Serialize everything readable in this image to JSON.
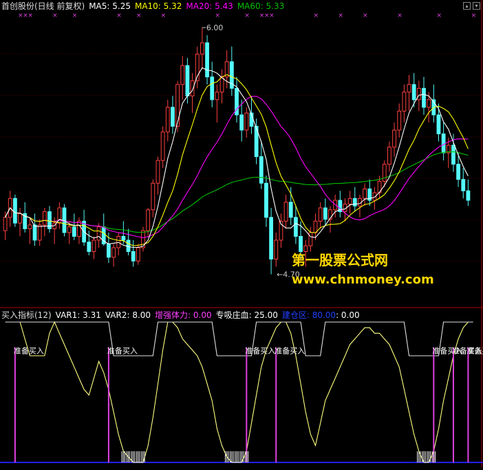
{
  "header_top": {
    "stock": "首创股份(日线 前复权)",
    "ma5": "MA5: 5.25",
    "ma10": "MA10: 5.32",
    "ma20": "MA20: 5.43",
    "ma60": "MA60: 5.33"
  },
  "header_bottom": {
    "name": "买入指标(12)",
    "var1": "VAR1: 3.31",
    "var2": "VAR2: 8.00",
    "zqtl": "增强体力: 0.00",
    "zxzx": "专吸庄血: 25.00",
    "zone": "建仓区: 80.00",
    "last": ": 0.00"
  },
  "watermark": {
    "line1": "第一股票公式网",
    "line2": "www.chnmoney.com"
  },
  "colors": {
    "up": "#ff4040",
    "down": "#54fcfc",
    "ma5": "#ffffff",
    "ma10": "#ffff00",
    "ma20": "#ff00ff",
    "ma60": "#00c000",
    "magenta": "#e040e0",
    "blue": "#2020ff"
  },
  "chart_data": {
    "type": "candlestick",
    "price_range": [
      4.55,
      6.08
    ],
    "high_label": "6.00",
    "low_label": "4.70",
    "candles": [
      [
        4.93,
        5.03,
        4.88,
        5.0
      ],
      [
        5.0,
        5.14,
        4.95,
        5.1
      ],
      [
        5.1,
        5.12,
        4.95,
        4.97
      ],
      [
        4.97,
        5.05,
        4.9,
        5.02
      ],
      [
        5.02,
        5.08,
        4.92,
        4.94
      ],
      [
        4.94,
        5.0,
        4.86,
        4.96
      ],
      [
        4.96,
        5.02,
        4.85,
        4.88
      ],
      [
        4.88,
        4.99,
        4.85,
        4.96
      ],
      [
        4.96,
        5.05,
        4.9,
        5.03
      ],
      [
        5.03,
        5.06,
        4.92,
        4.94
      ],
      [
        4.94,
        5.0,
        4.86,
        4.97
      ],
      [
        4.97,
        5.08,
        4.94,
        5.05
      ],
      [
        5.05,
        5.07,
        4.9,
        4.92
      ],
      [
        4.92,
        4.98,
        4.86,
        4.95
      ],
      [
        4.95,
        5.02,
        4.88,
        4.9
      ],
      [
        4.9,
        5.0,
        4.86,
        4.98
      ],
      [
        4.98,
        5.04,
        4.85,
        4.87
      ],
      [
        4.87,
        4.93,
        4.8,
        4.82
      ],
      [
        4.82,
        4.9,
        4.78,
        4.88
      ],
      [
        4.88,
        4.97,
        4.84,
        4.95
      ],
      [
        4.95,
        5.02,
        4.85,
        4.86
      ],
      [
        4.86,
        4.92,
        4.76,
        4.79
      ],
      [
        4.79,
        4.86,
        4.74,
        4.84
      ],
      [
        4.84,
        4.92,
        4.8,
        4.9
      ],
      [
        4.9,
        4.98,
        4.86,
        4.88
      ],
      [
        4.88,
        4.94,
        4.8,
        4.82
      ],
      [
        4.82,
        4.88,
        4.74,
        4.77
      ],
      [
        4.77,
        4.86,
        4.75,
        4.84
      ],
      [
        4.84,
        4.95,
        4.82,
        4.93
      ],
      [
        4.93,
        5.05,
        4.9,
        5.04
      ],
      [
        5.04,
        5.2,
        5.0,
        5.18
      ],
      [
        5.18,
        5.32,
        5.12,
        5.3
      ],
      [
        5.3,
        5.48,
        5.26,
        5.45
      ],
      [
        5.45,
        5.62,
        5.4,
        5.58
      ],
      [
        5.58,
        5.64,
        5.44,
        5.48
      ],
      [
        5.48,
        5.72,
        5.45,
        5.7
      ],
      [
        5.7,
        5.85,
        5.62,
        5.8
      ],
      [
        5.8,
        5.84,
        5.6,
        5.64
      ],
      [
        5.64,
        5.76,
        5.55,
        5.72
      ],
      [
        5.72,
        5.9,
        5.68,
        5.86
      ],
      [
        5.86,
        6.0,
        5.78,
        5.92
      ],
      [
        5.92,
        5.96,
        5.7,
        5.74
      ],
      [
        5.74,
        5.82,
        5.58,
        5.62
      ],
      [
        5.62,
        5.7,
        5.5,
        5.66
      ],
      [
        5.66,
        5.78,
        5.6,
        5.74
      ],
      [
        5.74,
        5.88,
        5.68,
        5.82
      ],
      [
        5.82,
        5.9,
        5.64,
        5.68
      ],
      [
        5.68,
        5.74,
        5.5,
        5.54
      ],
      [
        5.54,
        5.62,
        5.4,
        5.46
      ],
      [
        5.46,
        5.58,
        5.42,
        5.55
      ],
      [
        5.55,
        5.64,
        5.44,
        5.48
      ],
      [
        5.48,
        5.52,
        5.28,
        5.32
      ],
      [
        5.32,
        5.4,
        5.15,
        5.18
      ],
      [
        5.18,
        5.22,
        4.95,
        5.0
      ],
      [
        5.0,
        5.05,
        4.7,
        4.78
      ],
      [
        4.78,
        4.92,
        4.74,
        4.88
      ],
      [
        4.88,
        5.02,
        4.84,
        4.98
      ],
      [
        4.98,
        5.12,
        4.94,
        5.08
      ],
      [
        5.08,
        5.16,
        4.96,
        5.0
      ],
      [
        5.0,
        5.06,
        4.86,
        4.9
      ],
      [
        4.9,
        4.98,
        4.78,
        4.82
      ],
      [
        4.82,
        4.88,
        4.74,
        4.85
      ],
      [
        4.85,
        4.95,
        4.82,
        4.92
      ],
      [
        4.92,
        5.02,
        4.88,
        4.98
      ],
      [
        4.98,
        5.08,
        4.94,
        5.05
      ],
      [
        5.05,
        5.1,
        4.96,
        4.99
      ],
      [
        4.99,
        5.06,
        4.92,
        5.04
      ],
      [
        5.04,
        5.12,
        5.0,
        5.09
      ],
      [
        5.09,
        5.14,
        5.0,
        5.03
      ],
      [
        5.03,
        5.1,
        4.98,
        5.07
      ],
      [
        5.07,
        5.14,
        5.02,
        5.1
      ],
      [
        5.1,
        5.16,
        5.03,
        5.06
      ],
      [
        5.06,
        5.12,
        5.0,
        5.1
      ],
      [
        5.1,
        5.18,
        5.06,
        5.15
      ],
      [
        5.15,
        5.2,
        5.06,
        5.09
      ],
      [
        5.09,
        5.16,
        5.04,
        5.13
      ],
      [
        5.13,
        5.22,
        5.1,
        5.19
      ],
      [
        5.19,
        5.3,
        5.16,
        5.28
      ],
      [
        5.28,
        5.4,
        5.24,
        5.37
      ],
      [
        5.37,
        5.5,
        5.32,
        5.46
      ],
      [
        5.46,
        5.6,
        5.42,
        5.56
      ],
      [
        5.56,
        5.7,
        5.5,
        5.66
      ],
      [
        5.66,
        5.75,
        5.56,
        5.7
      ],
      [
        5.7,
        5.76,
        5.58,
        5.62
      ],
      [
        5.62,
        5.72,
        5.56,
        5.68
      ],
      [
        5.68,
        5.74,
        5.54,
        5.58
      ],
      [
        5.58,
        5.66,
        5.5,
        5.62
      ],
      [
        5.62,
        5.7,
        5.5,
        5.54
      ],
      [
        5.54,
        5.6,
        5.4,
        5.44
      ],
      [
        5.44,
        5.5,
        5.3,
        5.34
      ],
      [
        5.34,
        5.42,
        5.26,
        5.38
      ],
      [
        5.38,
        5.44,
        5.24,
        5.28
      ],
      [
        5.28,
        5.34,
        5.16,
        5.2
      ],
      [
        5.2,
        5.26,
        5.1,
        5.14
      ],
      [
        5.14,
        5.2,
        5.06,
        5.09
      ]
    ],
    "ind_range": [
      0,
      25
    ],
    "osc": [
      25,
      25,
      25,
      25,
      22,
      19,
      19,
      19,
      19,
      23,
      25,
      23,
      21,
      19,
      17,
      15,
      13,
      12,
      15,
      18,
      16,
      13,
      9,
      5,
      2,
      1,
      0,
      0,
      0,
      3,
      8,
      14,
      20,
      25,
      25,
      24,
      22,
      21,
      20,
      19,
      17,
      14,
      11,
      6,
      3,
      1,
      0,
      0,
      0,
      2,
      7,
      12,
      17,
      20,
      22,
      24,
      25,
      25,
      23,
      19,
      14,
      9,
      5,
      3,
      7,
      11,
      13,
      15,
      17,
      19,
      21,
      22,
      23,
      24,
      24,
      23,
      23,
      22,
      21,
      19,
      17,
      13,
      9,
      5,
      2,
      0,
      0,
      2,
      6,
      11,
      15,
      19,
      22,
      24,
      25,
      25
    ],
    "signals": [
      2,
      21,
      49,
      55,
      87,
      91,
      94
    ],
    "signal_label": "准备买入"
  }
}
